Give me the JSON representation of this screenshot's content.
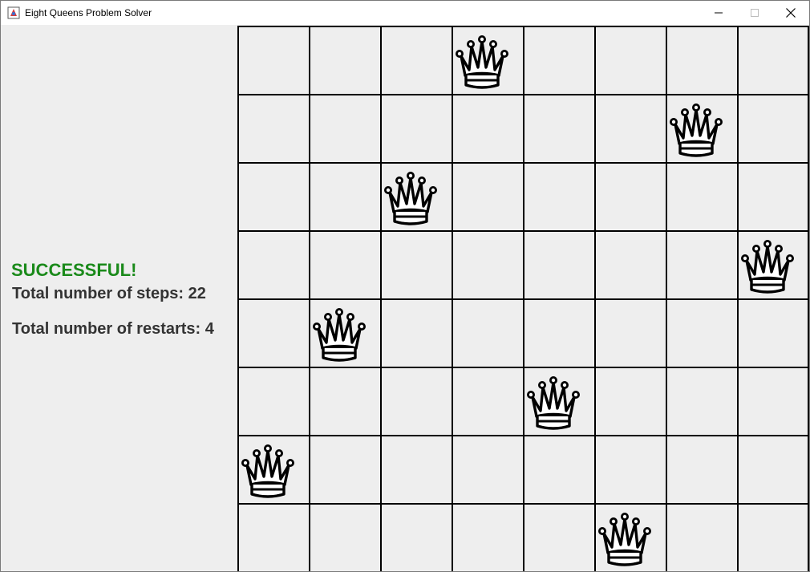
{
  "window": {
    "title": "Eight Queens Problem Solver",
    "controls": {
      "minimize": "—",
      "maximize": "☐",
      "close": "✕"
    }
  },
  "panel": {
    "status": "SUCCESSFUL!",
    "steps_label": "Total number of steps: 22",
    "restarts_label": "Total number of restarts: 4",
    "status_color": "#1a8a1a"
  },
  "board": {
    "size": 8,
    "queen_columns_by_row": [
      3,
      6,
      2,
      7,
      1,
      4,
      0,
      5
    ],
    "icon": "queen-icon"
  }
}
